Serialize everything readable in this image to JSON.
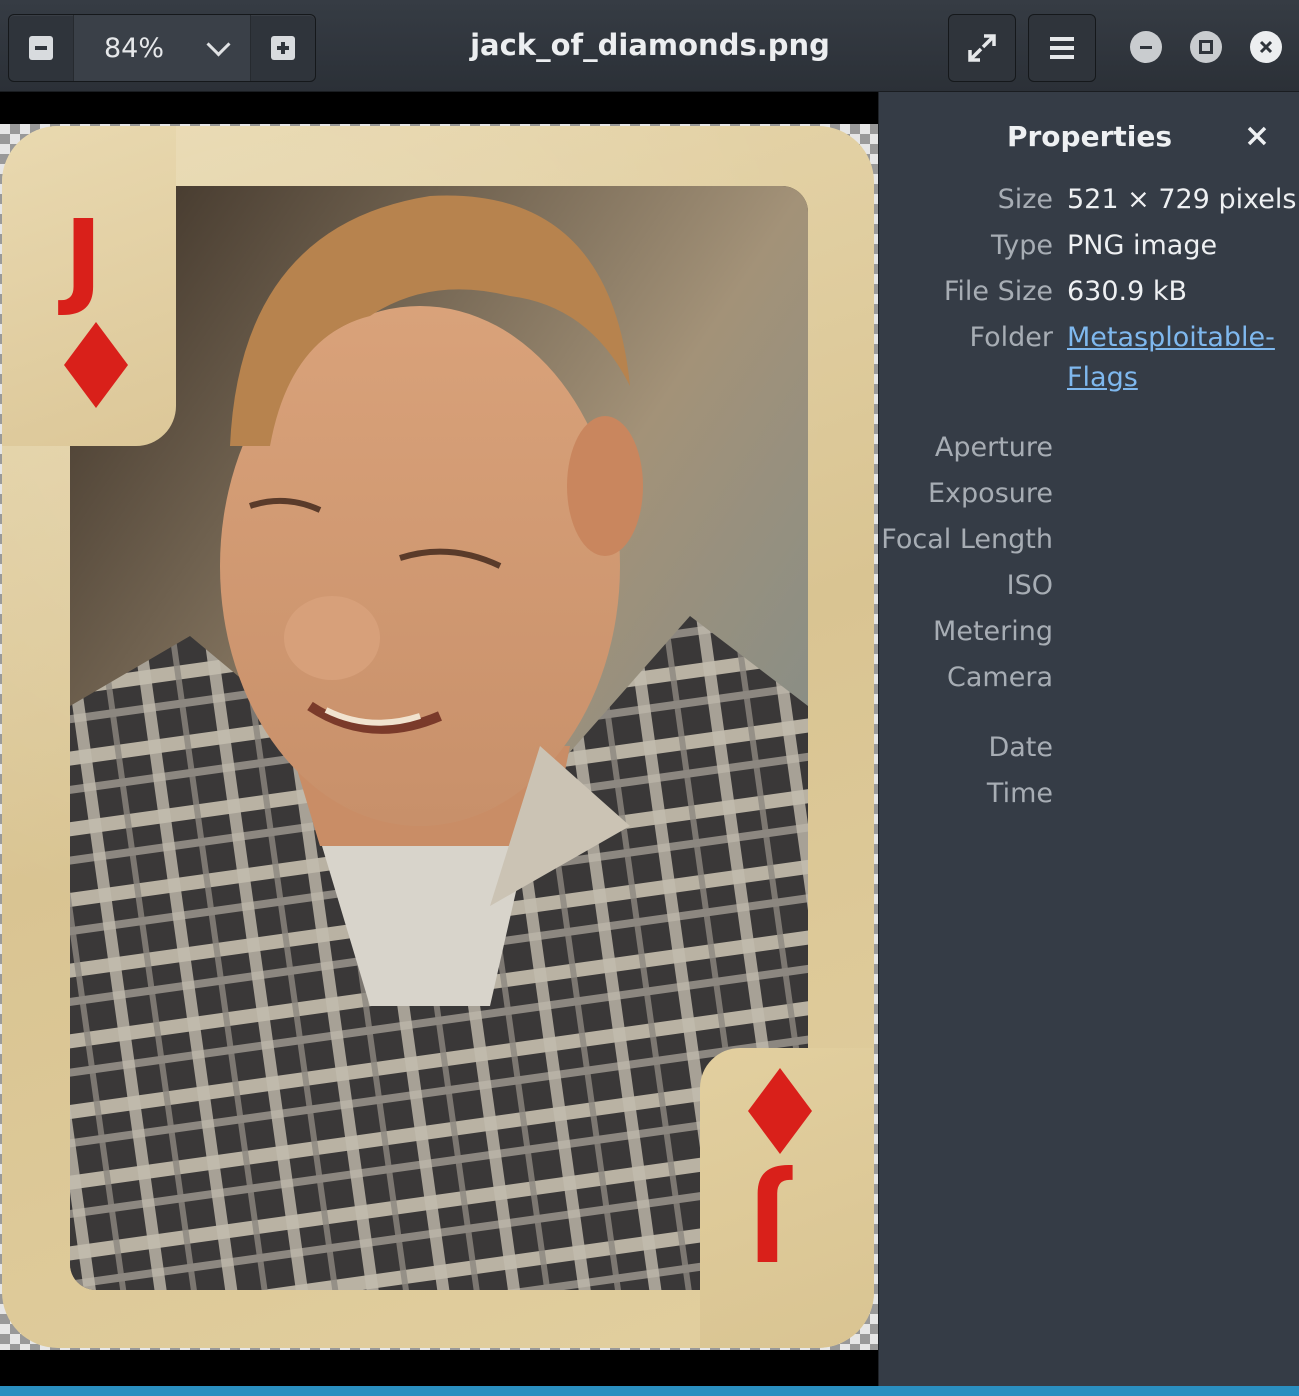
{
  "window": {
    "title": "jack_of_diamonds.png",
    "zoom": "84%"
  },
  "headerbar": {
    "zoom_out_icon": "minus-icon",
    "zoom_in_icon": "plus-icon",
    "fullscreen_icon": "fullscreen-icon",
    "menu_icon": "hamburger-menu-icon",
    "minimize_icon": "minimize-icon",
    "maximize_icon": "maximize-icon",
    "close_icon": "close-icon"
  },
  "image": {
    "rank": "J",
    "suit": "diamond",
    "suit_color": "#d9201a"
  },
  "properties": {
    "title": "Properties",
    "rows": [
      {
        "label": "Size",
        "value": "521 × 729 pixels"
      },
      {
        "label": "Type",
        "value": "PNG image"
      },
      {
        "label": "File Size",
        "value": "630.9 kB"
      },
      {
        "label": "Folder",
        "value": "Metasploitable-Flags"
      },
      {
        "label": "Aperture",
        "value": ""
      },
      {
        "label": "Exposure",
        "value": ""
      },
      {
        "label": "Focal Length",
        "value": ""
      },
      {
        "label": "ISO",
        "value": ""
      },
      {
        "label": "Metering",
        "value": ""
      },
      {
        "label": "Camera",
        "value": ""
      },
      {
        "label": "Date",
        "value": ""
      },
      {
        "label": "Time",
        "value": ""
      }
    ]
  },
  "colors": {
    "headerbar": "#2f343b",
    "panel": "#353c46",
    "link": "#7fb8ee",
    "accent": "#2a8fc0"
  }
}
